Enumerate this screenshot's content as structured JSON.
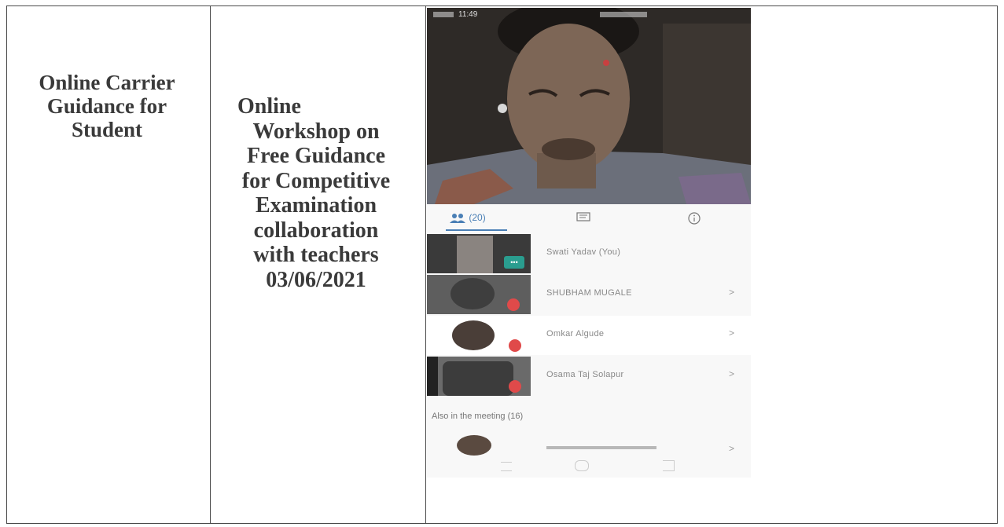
{
  "col1": {
    "lines": [
      "Online Carrier",
      "Guidance for",
      "Student"
    ]
  },
  "col2": {
    "lines": [
      "Online",
      "Workshop on",
      "Free Guidance",
      "for Competitive",
      "Examination",
      "collaboration",
      "with teachers",
      "03/06/2021"
    ]
  },
  "phone": {
    "status_time": "11:49",
    "tabs": {
      "participants_count": "(20)"
    },
    "participants": [
      {
        "name": "Swati Yadav (You)",
        "chevron": ""
      },
      {
        "name": "SHUBHAM MUGALE",
        "chevron": ">"
      },
      {
        "name": "Omkar Algude",
        "chevron": ">"
      },
      {
        "name": "Osama Taj Solapur",
        "chevron": ">"
      }
    ],
    "also_in_meeting": "Also in the meeting (16)",
    "partial_row_chevron": ">",
    "icons": {
      "participants_tab": "people-icon",
      "chat_tab": "chat-icon",
      "info_tab": "info-icon",
      "mic_off": "mic-off-icon",
      "nav_home": "home-icon"
    }
  }
}
